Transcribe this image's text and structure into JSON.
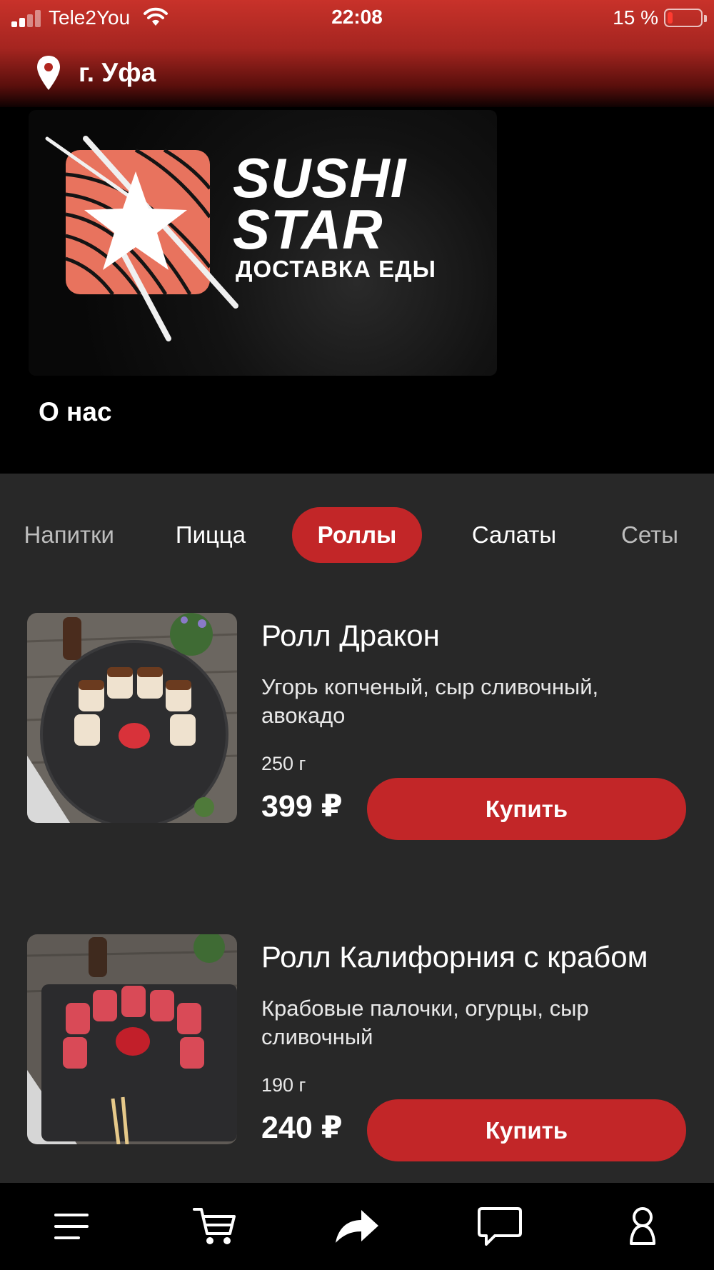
{
  "status_bar": {
    "carrier": "Tele2You",
    "time": "22:08",
    "battery_percent": "15 %",
    "battery_level": 0.15,
    "signal_bars": 4,
    "signal_bars_filled": 2
  },
  "header": {
    "city": "г. Уфа",
    "icon": "location-pin-icon"
  },
  "banner": {
    "brand_line1": "SUSHI",
    "brand_line2": "STAR",
    "brand_sub": "ДОСТАВКА ЕДЫ",
    "logo_color": "#e8735e"
  },
  "about_label": "О нас",
  "category_tabs": [
    {
      "label": "Напитки",
      "active": false
    },
    {
      "label": "Пицца",
      "active": false
    },
    {
      "label": "Роллы",
      "active": true
    },
    {
      "label": "Салаты",
      "active": false
    },
    {
      "label": "Сеты",
      "active": false
    }
  ],
  "products": [
    {
      "title": "Ролл Дракон",
      "description": "Угорь копченый, сыр сливочный, авокадо",
      "weight": "250 г",
      "price": "399 ₽",
      "buy_label": "Купить"
    },
    {
      "title": "Ролл Калифорния с крабом",
      "description": "Крабовые палочки, огурцы, сыр сливочный",
      "weight": "190 г",
      "price": "240 ₽",
      "buy_label": "Купить"
    }
  ],
  "bottom_nav": [
    {
      "icon": "menu-icon"
    },
    {
      "icon": "cart-icon"
    },
    {
      "icon": "share-icon"
    },
    {
      "icon": "chat-icon"
    },
    {
      "icon": "profile-icon"
    }
  ],
  "colors": {
    "accent": "#c22628",
    "header_top": "#c8322a",
    "content_bg": "#282828"
  }
}
